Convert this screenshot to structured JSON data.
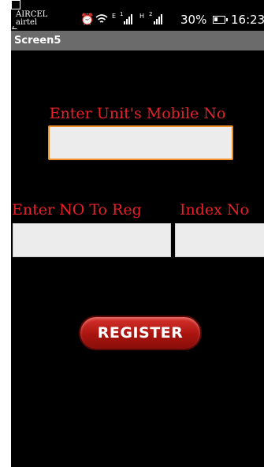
{
  "status_bar": {
    "carrier_1": "AIRCEL",
    "carrier_2": "airtel",
    "signal_1_type": "E",
    "signal_1_index": "1",
    "signal_2_type": "H",
    "signal_2_index": "2",
    "battery": "30%",
    "time": "16:23"
  },
  "app": {
    "title": "Screen5"
  },
  "form": {
    "mobile_label": "Enter Unit's Mobile No",
    "mobile_value": "",
    "regno_label": "Enter NO To Reg",
    "regno_value": "",
    "index_label": "Index No",
    "index_value": "",
    "register_button": "REGISTER"
  },
  "colors": {
    "background": "#000000",
    "label_red": "#e8202a",
    "focus_border": "#f0902a",
    "titlebar": "#6b6b6b"
  }
}
